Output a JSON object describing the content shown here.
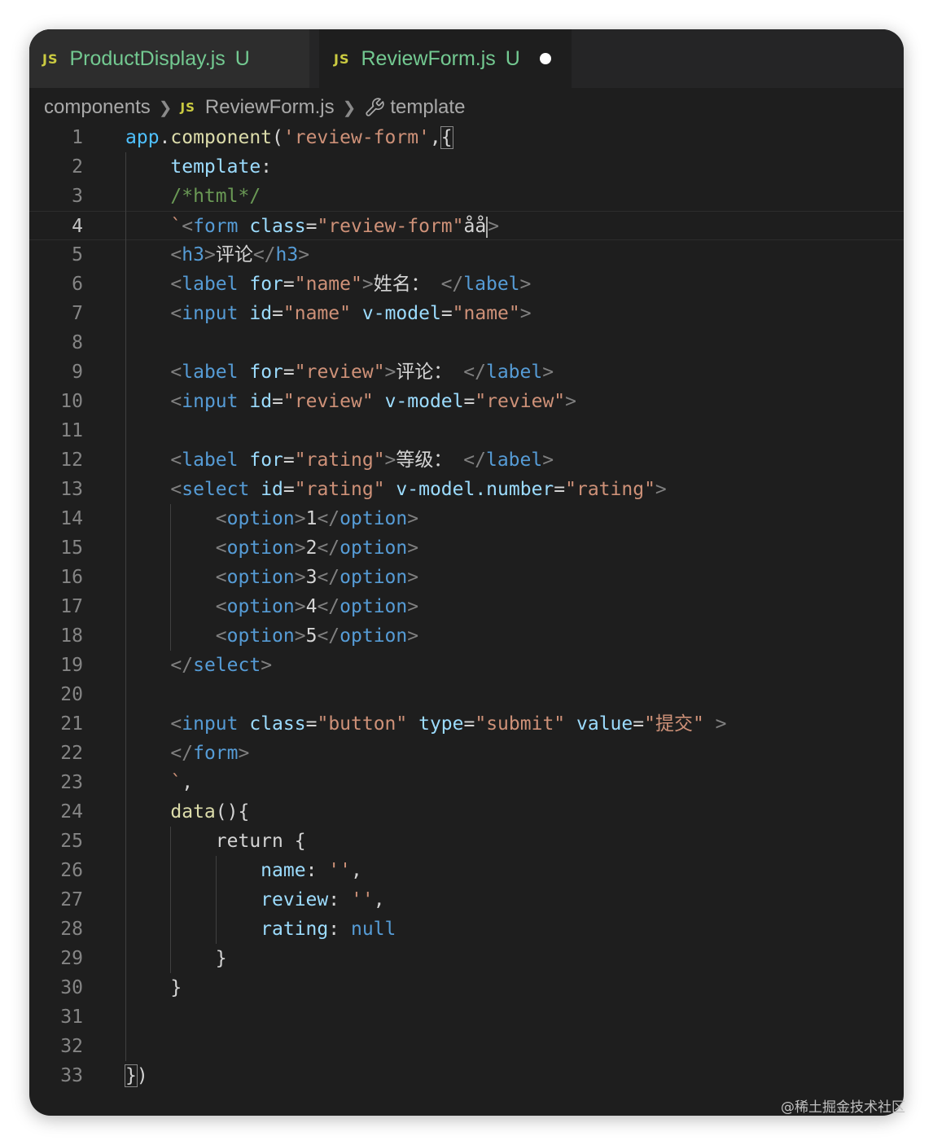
{
  "tabs": [
    {
      "icon": "JS",
      "name": "ProductDisplay.js",
      "status": "U",
      "active": false
    },
    {
      "icon": "JS",
      "name": "ReviewForm.js",
      "status": "U",
      "active": true,
      "unsaved_dot": true
    }
  ],
  "breadcrumb": {
    "folder": "components",
    "file_icon": "JS",
    "file": "ReviewForm.js",
    "symbol_icon": "wrench-icon",
    "symbol": "template"
  },
  "editor": {
    "current_line": 4,
    "lines": [
      [
        {
          "t": "app",
          "c": "#4fc1ff"
        },
        {
          "t": ".",
          "c": "#d4d4d4"
        },
        {
          "t": "component",
          "c": "#dcdcaa"
        },
        {
          "t": "(",
          "c": "#d4d4d4"
        },
        {
          "t": "'review-form'",
          "c": "#ce9178"
        },
        {
          "t": ",",
          "c": "#d4d4d4"
        },
        {
          "t": "{",
          "c": "#d4d4d4",
          "box": true
        }
      ],
      [
        {
          "t": "    "
        },
        {
          "t": "template",
          "c": "#9cdcfe"
        },
        {
          "t": ":",
          "c": "#d4d4d4"
        }
      ],
      [
        {
          "t": "    "
        },
        {
          "t": "/*html*/",
          "c": "#6a9955"
        }
      ],
      [
        {
          "t": "    "
        },
        {
          "t": "`",
          "c": "#ce9178"
        },
        {
          "t": "<",
          "c": "#808080"
        },
        {
          "t": "form",
          "c": "#569cd6"
        },
        {
          "t": " "
        },
        {
          "t": "class",
          "c": "#9cdcfe"
        },
        {
          "t": "=",
          "c": "#d4d4d4"
        },
        {
          "t": "\"review-form\"",
          "c": "#ce9178"
        },
        {
          "t": "åå",
          "c": "#d4d4d4",
          "cursor": true
        },
        {
          "t": ">",
          "c": "#808080"
        }
      ],
      [
        {
          "t": "    "
        },
        {
          "t": "<",
          "c": "#808080"
        },
        {
          "t": "h3",
          "c": "#569cd6"
        },
        {
          "t": ">",
          "c": "#808080"
        },
        {
          "t": "评论",
          "c": "#d4d4d4"
        },
        {
          "t": "</",
          "c": "#808080"
        },
        {
          "t": "h3",
          "c": "#569cd6"
        },
        {
          "t": ">",
          "c": "#808080"
        }
      ],
      [
        {
          "t": "    "
        },
        {
          "t": "<",
          "c": "#808080"
        },
        {
          "t": "label",
          "c": "#569cd6"
        },
        {
          "t": " "
        },
        {
          "t": "for",
          "c": "#9cdcfe"
        },
        {
          "t": "=",
          "c": "#d4d4d4"
        },
        {
          "t": "\"name\"",
          "c": "#ce9178"
        },
        {
          "t": ">",
          "c": "#808080"
        },
        {
          "t": "姓名： ",
          "c": "#d4d4d4"
        },
        {
          "t": "</",
          "c": "#808080"
        },
        {
          "t": "label",
          "c": "#569cd6"
        },
        {
          "t": ">",
          "c": "#808080"
        }
      ],
      [
        {
          "t": "    "
        },
        {
          "t": "<",
          "c": "#808080"
        },
        {
          "t": "input",
          "c": "#569cd6"
        },
        {
          "t": " "
        },
        {
          "t": "id",
          "c": "#9cdcfe"
        },
        {
          "t": "=",
          "c": "#d4d4d4"
        },
        {
          "t": "\"name\"",
          "c": "#ce9178"
        },
        {
          "t": " "
        },
        {
          "t": "v-model",
          "c": "#9cdcfe"
        },
        {
          "t": "=",
          "c": "#d4d4d4"
        },
        {
          "t": "\"name\"",
          "c": "#ce9178"
        },
        {
          "t": ">",
          "c": "#808080"
        }
      ],
      [],
      [
        {
          "t": "    "
        },
        {
          "t": "<",
          "c": "#808080"
        },
        {
          "t": "label",
          "c": "#569cd6"
        },
        {
          "t": " "
        },
        {
          "t": "for",
          "c": "#9cdcfe"
        },
        {
          "t": "=",
          "c": "#d4d4d4"
        },
        {
          "t": "\"review\"",
          "c": "#ce9178"
        },
        {
          "t": ">",
          "c": "#808080"
        },
        {
          "t": "评论： ",
          "c": "#d4d4d4"
        },
        {
          "t": "</",
          "c": "#808080"
        },
        {
          "t": "label",
          "c": "#569cd6"
        },
        {
          "t": ">",
          "c": "#808080"
        }
      ],
      [
        {
          "t": "    "
        },
        {
          "t": "<",
          "c": "#808080"
        },
        {
          "t": "input",
          "c": "#569cd6"
        },
        {
          "t": " "
        },
        {
          "t": "id",
          "c": "#9cdcfe"
        },
        {
          "t": "=",
          "c": "#d4d4d4"
        },
        {
          "t": "\"review\"",
          "c": "#ce9178"
        },
        {
          "t": " "
        },
        {
          "t": "v-model",
          "c": "#9cdcfe"
        },
        {
          "t": "=",
          "c": "#d4d4d4"
        },
        {
          "t": "\"review\"",
          "c": "#ce9178"
        },
        {
          "t": ">",
          "c": "#808080"
        }
      ],
      [],
      [
        {
          "t": "    "
        },
        {
          "t": "<",
          "c": "#808080"
        },
        {
          "t": "label",
          "c": "#569cd6"
        },
        {
          "t": " "
        },
        {
          "t": "for",
          "c": "#9cdcfe"
        },
        {
          "t": "=",
          "c": "#d4d4d4"
        },
        {
          "t": "\"rating\"",
          "c": "#ce9178"
        },
        {
          "t": ">",
          "c": "#808080"
        },
        {
          "t": "等级： ",
          "c": "#d4d4d4"
        },
        {
          "t": "</",
          "c": "#808080"
        },
        {
          "t": "label",
          "c": "#569cd6"
        },
        {
          "t": ">",
          "c": "#808080"
        }
      ],
      [
        {
          "t": "    "
        },
        {
          "t": "<",
          "c": "#808080"
        },
        {
          "t": "select",
          "c": "#569cd6"
        },
        {
          "t": " "
        },
        {
          "t": "id",
          "c": "#9cdcfe"
        },
        {
          "t": "=",
          "c": "#d4d4d4"
        },
        {
          "t": "\"rating\"",
          "c": "#ce9178"
        },
        {
          "t": " "
        },
        {
          "t": "v-model.number",
          "c": "#9cdcfe"
        },
        {
          "t": "=",
          "c": "#d4d4d4"
        },
        {
          "t": "\"rating\"",
          "c": "#ce9178"
        },
        {
          "t": ">",
          "c": "#808080"
        }
      ],
      [
        {
          "t": "        "
        },
        {
          "t": "<",
          "c": "#808080"
        },
        {
          "t": "option",
          "c": "#569cd6"
        },
        {
          "t": ">",
          "c": "#808080"
        },
        {
          "t": "1",
          "c": "#d4d4d4"
        },
        {
          "t": "</",
          "c": "#808080"
        },
        {
          "t": "option",
          "c": "#569cd6"
        },
        {
          "t": ">",
          "c": "#808080"
        }
      ],
      [
        {
          "t": "        "
        },
        {
          "t": "<",
          "c": "#808080"
        },
        {
          "t": "option",
          "c": "#569cd6"
        },
        {
          "t": ">",
          "c": "#808080"
        },
        {
          "t": "2",
          "c": "#d4d4d4"
        },
        {
          "t": "</",
          "c": "#808080"
        },
        {
          "t": "option",
          "c": "#569cd6"
        },
        {
          "t": ">",
          "c": "#808080"
        }
      ],
      [
        {
          "t": "        "
        },
        {
          "t": "<",
          "c": "#808080"
        },
        {
          "t": "option",
          "c": "#569cd6"
        },
        {
          "t": ">",
          "c": "#808080"
        },
        {
          "t": "3",
          "c": "#d4d4d4"
        },
        {
          "t": "</",
          "c": "#808080"
        },
        {
          "t": "option",
          "c": "#569cd6"
        },
        {
          "t": ">",
          "c": "#808080"
        }
      ],
      [
        {
          "t": "        "
        },
        {
          "t": "<",
          "c": "#808080"
        },
        {
          "t": "option",
          "c": "#569cd6"
        },
        {
          "t": ">",
          "c": "#808080"
        },
        {
          "t": "4",
          "c": "#d4d4d4"
        },
        {
          "t": "</",
          "c": "#808080"
        },
        {
          "t": "option",
          "c": "#569cd6"
        },
        {
          "t": ">",
          "c": "#808080"
        }
      ],
      [
        {
          "t": "        "
        },
        {
          "t": "<",
          "c": "#808080"
        },
        {
          "t": "option",
          "c": "#569cd6"
        },
        {
          "t": ">",
          "c": "#808080"
        },
        {
          "t": "5",
          "c": "#d4d4d4"
        },
        {
          "t": "</",
          "c": "#808080"
        },
        {
          "t": "option",
          "c": "#569cd6"
        },
        {
          "t": ">",
          "c": "#808080"
        }
      ],
      [
        {
          "t": "    "
        },
        {
          "t": "</",
          "c": "#808080"
        },
        {
          "t": "select",
          "c": "#569cd6"
        },
        {
          "t": ">",
          "c": "#808080"
        }
      ],
      [],
      [
        {
          "t": "    "
        },
        {
          "t": "<",
          "c": "#808080"
        },
        {
          "t": "input",
          "c": "#569cd6"
        },
        {
          "t": " "
        },
        {
          "t": "class",
          "c": "#9cdcfe"
        },
        {
          "t": "=",
          "c": "#d4d4d4"
        },
        {
          "t": "\"button\"",
          "c": "#ce9178"
        },
        {
          "t": " "
        },
        {
          "t": "type",
          "c": "#9cdcfe"
        },
        {
          "t": "=",
          "c": "#d4d4d4"
        },
        {
          "t": "\"submit\"",
          "c": "#ce9178"
        },
        {
          "t": " "
        },
        {
          "t": "value",
          "c": "#9cdcfe"
        },
        {
          "t": "=",
          "c": "#d4d4d4"
        },
        {
          "t": "\"提交\"",
          "c": "#ce9178"
        },
        {
          "t": " "
        },
        {
          "t": ">",
          "c": "#808080"
        }
      ],
      [
        {
          "t": "    "
        },
        {
          "t": "</",
          "c": "#808080"
        },
        {
          "t": "form",
          "c": "#569cd6"
        },
        {
          "t": ">",
          "c": "#808080"
        }
      ],
      [
        {
          "t": "    "
        },
        {
          "t": "`",
          "c": "#ce9178"
        },
        {
          "t": ",",
          "c": "#d4d4d4"
        }
      ],
      [
        {
          "t": "    "
        },
        {
          "t": "data",
          "c": "#dcdcaa"
        },
        {
          "t": "(){",
          "c": "#d4d4d4"
        }
      ],
      [
        {
          "t": "        "
        },
        {
          "t": "return",
          "c": "#d4d4d4"
        },
        {
          "t": " {",
          "c": "#d4d4d4"
        }
      ],
      [
        {
          "t": "            "
        },
        {
          "t": "name",
          "c": "#9cdcfe"
        },
        {
          "t": ":",
          "c": "#d4d4d4"
        },
        {
          "t": " "
        },
        {
          "t": "''",
          "c": "#ce9178"
        },
        {
          "t": ",",
          "c": "#d4d4d4"
        }
      ],
      [
        {
          "t": "            "
        },
        {
          "t": "review",
          "c": "#9cdcfe"
        },
        {
          "t": ":",
          "c": "#d4d4d4"
        },
        {
          "t": " "
        },
        {
          "t": "''",
          "c": "#ce9178"
        },
        {
          "t": ",",
          "c": "#d4d4d4"
        }
      ],
      [
        {
          "t": "            "
        },
        {
          "t": "rating",
          "c": "#9cdcfe"
        },
        {
          "t": ":",
          "c": "#d4d4d4"
        },
        {
          "t": " "
        },
        {
          "t": "null",
          "c": "#569cd6"
        }
      ],
      [
        {
          "t": "        "
        },
        {
          "t": "}",
          "c": "#d4d4d4"
        }
      ],
      [
        {
          "t": "    "
        },
        {
          "t": "}",
          "c": "#d4d4d4"
        }
      ],
      [],
      [],
      [
        {
          "t": "}",
          "c": "#d4d4d4",
          "box": true
        },
        {
          "t": ")",
          "c": "#d4d4d4"
        }
      ]
    ]
  },
  "watermark": "@稀土掘金技术社区",
  "colors": {
    "editor_bg": "#1e1e1e",
    "tab_bar_bg": "#252526",
    "untracked_green": "#73c991",
    "js_icon_yellow": "#cbcb41",
    "keyword_blue": "#569cd6",
    "string_orange": "#ce9178",
    "attr_lightblue": "#9cdcfe",
    "function_yellow": "#dcdcaa",
    "comment_green": "#6a9955"
  }
}
